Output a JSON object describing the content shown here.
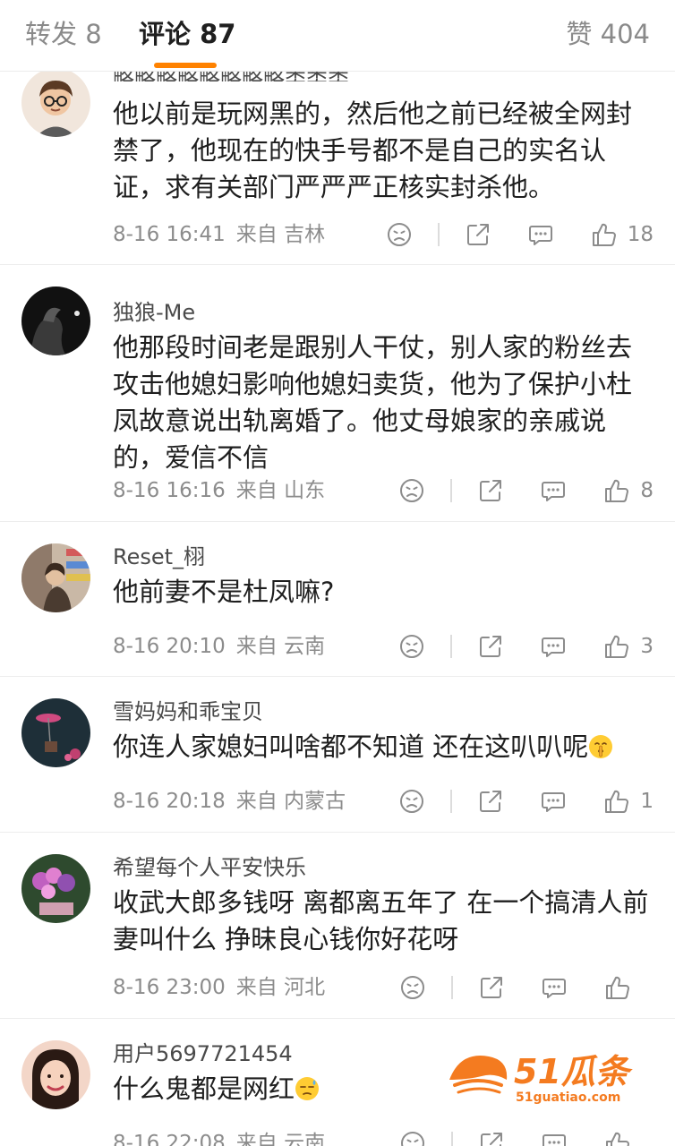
{
  "tabs": {
    "repost": "转发 8",
    "comments": "评论 87",
    "likes": "赞 404"
  },
  "comments": [
    {
      "author": "略略略略略略略略类类类",
      "text": "他以前是玩网黑的，然后他之前已经被全网封禁了，他现在的快手号都不是自己的实名认证，求有关部门严严严正核实封杀他。",
      "time": "8-16 16:41",
      "location": "来自 吉林",
      "likes": "18"
    },
    {
      "author": "独狼-Me",
      "text": "他那段时间老是跟别人干仗，别人家的粉丝去攻击他媳妇影响他媳妇卖货，他为了保护小杜凤故意说出轨离婚了。他丈母娘家的亲戚说的，爱信不信",
      "time": "8-16 16:16",
      "location": "来自 山东",
      "likes": "8"
    },
    {
      "author": "Reset_栩",
      "text": "他前妻不是杜凤嘛?",
      "time": "8-16 20:10",
      "location": "来自 云南",
      "likes": "3"
    },
    {
      "author": "雪妈妈和乖宝贝",
      "text": "你连人家媳妇叫啥都不知道  还在这叭叭呢",
      "time": "8-16 20:18",
      "location": "来自 内蒙古",
      "likes": "1"
    },
    {
      "author": "希望每个人平安快乐",
      "text": "收武大郎多钱呀 离都离五年了 在一个搞清人前妻叫什么 挣昧良心钱你好花呀",
      "time": "8-16 23:00",
      "location": "来自 河北",
      "likes": ""
    },
    {
      "author": "用户5697721454",
      "text": "什么鬼都是网红",
      "time": "8-16 22:08",
      "location": "来自 云南",
      "likes": ""
    }
  ],
  "watermark": {
    "brand": "51瓜条",
    "domain": "51guatiao.com"
  },
  "colors": {
    "accent": "#ff8200",
    "watermark": "#f47b20"
  },
  "icons": [
    "dislike-icon",
    "share-icon",
    "comment-icon",
    "like-icon",
    "shush-emoji",
    "sweat-emoji"
  ]
}
